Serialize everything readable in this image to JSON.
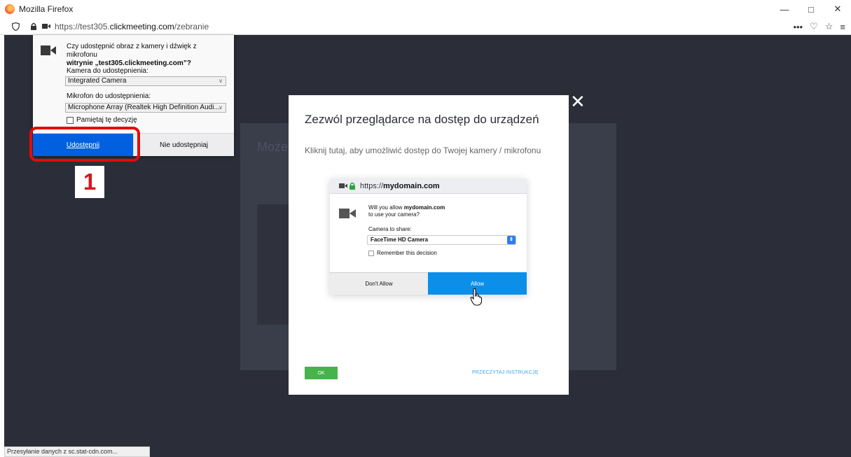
{
  "window": {
    "title": "Mozilla Firefox",
    "controls": {
      "minimize": "—",
      "restore": "□",
      "close": "✕"
    }
  },
  "urlbar": {
    "prefix": "https://test305.",
    "domain": "clickmeeting.com",
    "path": "/zebranie"
  },
  "toolbar": {
    "more": "•••",
    "pocket": "♡",
    "star": "☆",
    "menu": "≡"
  },
  "permission": {
    "message_line1": "Czy udostępnić obraz z kamery i dźwięk z mikrofonu",
    "message_line2": "witrynie „test305.clickmeeting.com”?",
    "camera_label": "Kamera do udostępnienia:",
    "camera_value": "Integrated Camera",
    "mic_label": "Mikrofon do udostępnienia:",
    "mic_value": "Microphone Array (Realtek High Definition Audi...",
    "remember_label": "Pamiętaj tę decyzję",
    "share_button": "Udostępnij",
    "noshare_button": "Nie udostępniaj"
  },
  "annotation": {
    "step": "1"
  },
  "background": {
    "title_fragment": "Może"
  },
  "modal": {
    "close": "✕",
    "title": "Zezwól przeglądarce na dostęp do urządzeń",
    "subtitle": "Kliknij tutaj, aby umożliwić dostęp do Twojej kamery / mikrofonu",
    "demo": {
      "url_prefix": "https://",
      "url_domain": "mydomain.com",
      "question_line1_pre": "Will you allow ",
      "question_domain": "mydomain.com",
      "question_line2": "to use your camera?",
      "camera_label": "Camera to share:",
      "camera_value": "FaceTime HD Camera",
      "remember_label": "Remember this decision",
      "deny_button": "Don't Allow",
      "allow_button": "Allow"
    },
    "ok_button": "OK",
    "read_link": "PRZECZYTAJ INSTRUKCJĘ"
  },
  "status_bar": {
    "text": "Przesyłanie danych z sc.stat-cdn.com..."
  }
}
